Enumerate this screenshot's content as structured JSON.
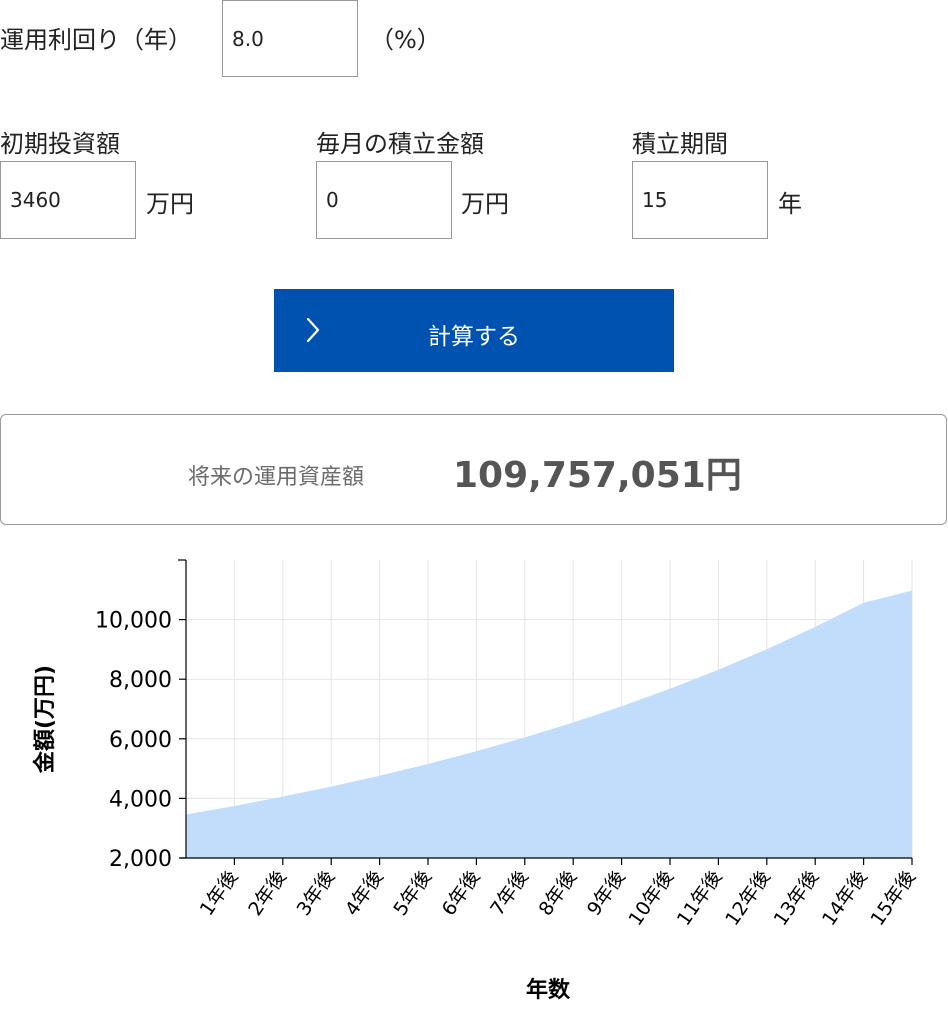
{
  "form": {
    "rate": {
      "label": "運用利回り（年）",
      "value": "8.0",
      "unit": "（%）"
    },
    "initial": {
      "label": "初期投資額",
      "value": "3460",
      "unit": "万円"
    },
    "monthly": {
      "label": "毎月の積立金額",
      "value": "0",
      "unit": "万円"
    },
    "period": {
      "label": "積立期間",
      "value": "15",
      "unit": "年"
    }
  },
  "calculate_button": {
    "label": "計算する",
    "icon": "chevron-right-icon"
  },
  "result": {
    "label": "将来の運用資産額",
    "value": "109,757,051円"
  },
  "colors": {
    "button": "#0052b0",
    "area": "#c2dcfc",
    "grid": "#e4e4e4",
    "border": "#9a9a9a"
  },
  "chart_data": {
    "type": "area",
    "x": [
      "",
      "1年後",
      "2年後",
      "3年後",
      "4年後",
      "5年後",
      "6年後",
      "7年後",
      "8年後",
      "9年後",
      "10年後",
      "11年後",
      "12年後",
      "13年後",
      "14年後",
      "15年後"
    ],
    "values": [
      3460,
      3747,
      4058,
      4395,
      4760,
      5155,
      5583,
      6046,
      6548,
      7091,
      7680,
      8317,
      9007,
      9754,
      10564,
      10976
    ],
    "xlabel": "年数",
    "ylabel": "金額(万円)",
    "ylim": [
      2000,
      12000
    ],
    "yticks": [
      2000,
      4000,
      6000,
      8000,
      10000
    ],
    "ytick_labels": [
      "2,000",
      "4,000",
      "6,000",
      "8,000",
      "10,000"
    ],
    "grid": true
  }
}
